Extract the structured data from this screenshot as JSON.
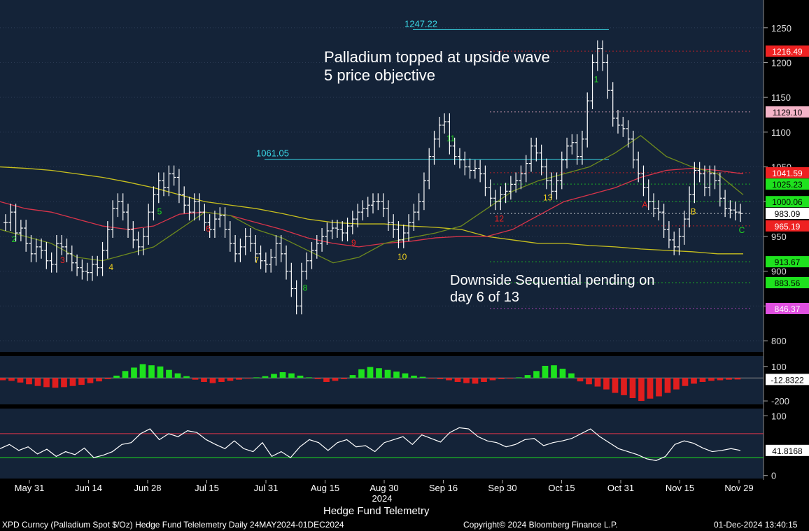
{
  "header": {
    "title": "Hedge Fund Telemetry",
    "footer_left": "XPD Curncy (Palladium Spot  $/Oz) Hedge Fund Telelemetry  Daily 24MAY2024-01DEC2024",
    "footer_center": "Copyright© 2024 Bloomberg Finance L.P.",
    "footer_right": "01-Dec-2024 13:40:15"
  },
  "annotations": {
    "topped_line1": "Palladium topped at upside wave",
    "topped_line2": "5 price objective",
    "pending_line1": "Downside Sequential pending on",
    "pending_line2": "day 6 of 13"
  },
  "colors": {
    "panel_bg": "#142338",
    "axis_bg": "#000000",
    "bar": "#ffffff",
    "ma_yellow": "#c8c01e",
    "ma_red": "#d9344a",
    "ma_olive": "#6e8a1e",
    "green_count": "#22d622",
    "red_count": "#ee2222",
    "cyan": "#3ad8e6",
    "yellow": "#f2d21e",
    "hist_pos": "#1ee21e",
    "hist_neg": "#e01e1e",
    "pink": "#f4b4c8"
  },
  "chart_data": [
    {
      "type": "ohlc",
      "title": "",
      "ylim": [
        790,
        1290
      ],
      "yticks": [
        800,
        850,
        900,
        950,
        1000,
        1050,
        1100,
        1150,
        1200,
        1250
      ],
      "x_tick_labels": [
        "May 31",
        "Jun 14",
        "Jun 28",
        "Jul 15",
        "Jul 31",
        "Aug 15",
        "Aug 30",
        "Sep 16",
        "Sep 30",
        "Oct 15",
        "Oct 31",
        "Nov 15",
        "Nov 29"
      ],
      "year_label": "2024",
      "series": [
        {
          "label_kind": "close",
          "close": [
            970,
            985,
            955,
            962,
            940,
            925,
            935,
            930,
            915,
            910,
            940,
            935,
            925,
            912,
            905,
            900,
            898,
            910,
            905,
            930,
            960,
            990,
            1000,
            985,
            960,
            945,
            935,
            950,
            985,
            1010,
            1030,
            1020,
            1040,
            1035,
            1010,
            995,
            985,
            1000,
            985,
            970,
            960,
            975,
            980,
            960,
            940,
            925,
            935,
            950,
            940,
            925,
            915,
            910,
            920,
            940,
            925,
            900,
            875,
            850,
            900,
            915,
            930,
            940,
            950,
            958,
            962,
            960,
            955,
            965,
            975,
            985,
            990,
            995,
            1000,
            1000,
            990,
            970,
            960,
            945,
            955,
            970,
            985,
            1000,
            1030,
            1065,
            1090,
            1110,
            1115,
            1080,
            1065,
            1060,
            1050,
            1045,
            1048,
            1040,
            1020,
            1005,
            1000,
            1010,
            1015,
            1025,
            1030,
            1040,
            1055,
            1080,
            1070,
            1050,
            1030,
            1015,
            1030,
            1060,
            1080,
            1085,
            1065,
            1090,
            1145,
            1200,
            1220,
            1200,
            1160,
            1120,
            1110,
            1105,
            1090,
            1060,
            1040,
            1020,
            1000,
            990,
            985,
            960,
            945,
            935,
            950,
            975,
            1010,
            1045,
            1040,
            1020,
            1040,
            1030,
            1005,
            990,
            988,
            985,
            983
          ]
        },
        {
          "name": "",
          "color_key": "ma_yellow",
          "values": [
            1050,
            1048,
            1045,
            1040,
            1035,
            1028,
            1020,
            1010,
            1000,
            995,
            990,
            983,
            975,
            970,
            968,
            968,
            965,
            963,
            960,
            950,
            945,
            940,
            940,
            937,
            935,
            932,
            930,
            928,
            925,
            925
          ]
        },
        {
          "name": "",
          "color_key": "ma_red",
          "values": [
            1000,
            990,
            985,
            975,
            965,
            960,
            965,
            982,
            985,
            980,
            970,
            960,
            948,
            940,
            935,
            940,
            943,
            948,
            950,
            950,
            960,
            980,
            1000,
            1010,
            1020,
            1035,
            1045,
            1048,
            1045,
            1040
          ]
        },
        {
          "name": "",
          "color_key": "ma_olive",
          "values": [
            960,
            950,
            940,
            920,
            915,
            925,
            935,
            960,
            985,
            980,
            960,
            948,
            930,
            912,
            920,
            940,
            948,
            955,
            965,
            990,
            1015,
            1030,
            1040,
            1050,
            1070,
            1095,
            1065,
            1050,
            1040,
            1010
          ]
        }
      ],
      "price_labels": [
        {
          "value": 1216.49,
          "text": "1216.49",
          "color_key": "red_count"
        },
        {
          "value": 1129.1,
          "text": "1129.10",
          "color_key": "pink"
        },
        {
          "value": 1041.59,
          "text": "1041.59",
          "color_key": "red_count"
        },
        {
          "value": 1025.23,
          "text": "1025.23",
          "color_key": "hist_pos"
        },
        {
          "value": 1000.06,
          "text": "1000.06",
          "color_key": "hist_pos"
        },
        {
          "value": 983.09,
          "text": "983.09",
          "color_key": "bar"
        },
        {
          "value": 965.19,
          "text": "965.19",
          "color_key": "red_count"
        },
        {
          "value": 913.67,
          "text": "913.67",
          "color_key": "hist_pos"
        },
        {
          "value": 883.56,
          "text": "883.56",
          "color_key": "hist_pos"
        },
        {
          "value": 846.37,
          "text": "846.37",
          "color_key": "magenta"
        }
      ],
      "level_labels": [
        {
          "value": 1247.22,
          "text": "1247.22"
        },
        {
          "value": 1061.05,
          "text": "1061.05"
        }
      ],
      "count_labels": [
        "2",
        "3",
        "4",
        "5",
        "6",
        "7",
        "8",
        "9",
        "10",
        "11",
        "12",
        "13",
        "1",
        "A",
        "B",
        "C"
      ]
    },
    {
      "type": "bar",
      "title": "",
      "ylim": [
        -230,
        190
      ],
      "yticks": [
        100,
        -200
      ],
      "last_value_label": "-12.8322",
      "values": [
        -20,
        -25,
        -40,
        -55,
        -70,
        -80,
        -85,
        -80,
        -70,
        -60,
        -45,
        -30,
        -10,
        20,
        60,
        90,
        120,
        110,
        100,
        70,
        40,
        15,
        -15,
        -35,
        -45,
        -35,
        -25,
        -15,
        -5,
        5,
        15,
        35,
        50,
        40,
        20,
        5,
        -10,
        -35,
        -25,
        -10,
        25,
        75,
        95,
        85,
        70,
        55,
        40,
        20,
        10,
        -5,
        -10,
        -20,
        -35,
        -45,
        -50,
        -35,
        -20,
        -10,
        -5,
        5,
        25,
        60,
        105,
        110,
        80,
        40,
        -30,
        -55,
        -75,
        -100,
        -130,
        -150,
        -175,
        -200,
        -180,
        -160,
        -130,
        -100,
        -70,
        -50,
        -35,
        -25,
        -20,
        -15,
        -13
      ]
    },
    {
      "type": "line",
      "title": "",
      "ylim": [
        -5,
        112
      ],
      "yticks": [
        100,
        0
      ],
      "upper_band": 70,
      "lower_band": 30,
      "last_value_label": "41.8168",
      "values": [
        45,
        52,
        42,
        48,
        36,
        44,
        32,
        40,
        35,
        46,
        30,
        34,
        40,
        52,
        55,
        70,
        78,
        60,
        70,
        65,
        75,
        72,
        60,
        52,
        45,
        58,
        45,
        40,
        55,
        32,
        40,
        30,
        48,
        60,
        55,
        42,
        55,
        60,
        48,
        50,
        40,
        55,
        60,
        65,
        52,
        68,
        62,
        56,
        72,
        80,
        78,
        65,
        58,
        55,
        48,
        52,
        60,
        62,
        50,
        55,
        58,
        62,
        70,
        78,
        65,
        55,
        45,
        40,
        35,
        28,
        25,
        32,
        52,
        58,
        54,
        46,
        40,
        42,
        45,
        42
      ]
    }
  ]
}
